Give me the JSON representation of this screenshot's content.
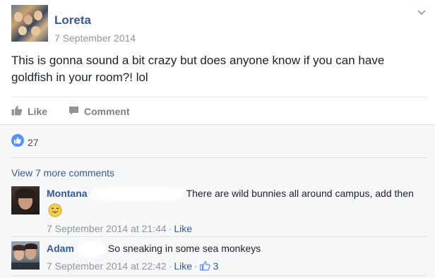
{
  "post": {
    "author": "Loreta",
    "date": "7 September 2014",
    "text": "This is gonna sound a bit crazy but does anyone know if you can have goldfish in your room?! lol",
    "actions": {
      "like_label": "Like",
      "comment_label": "Comment"
    },
    "likes_count": "27"
  },
  "comments_section": {
    "view_more_label": "View 7 more comments",
    "comments": [
      {
        "author": "Montana",
        "text": "There are wild bunnies all around campus, add then",
        "timestamp": "7 September 2014 at 21:44",
        "like_label": "Like"
      },
      {
        "author": "Adam",
        "text": "So sneaking in some sea monkeys",
        "timestamp": "7 September 2014 at 22:42",
        "like_label": "Like",
        "likes_count": "3"
      }
    ]
  },
  "icons": {
    "chevron": "chevron-down-icon",
    "like": "thumbs-up-icon",
    "comment": "comment-bubble-icon",
    "like_badge": "like-badge-icon",
    "emoji": "laughing-emoji-icon"
  },
  "colors": {
    "link": "#365899",
    "muted": "#90949c",
    "like_blue": "#5890ff",
    "comments_bg": "#f6f7f9"
  }
}
